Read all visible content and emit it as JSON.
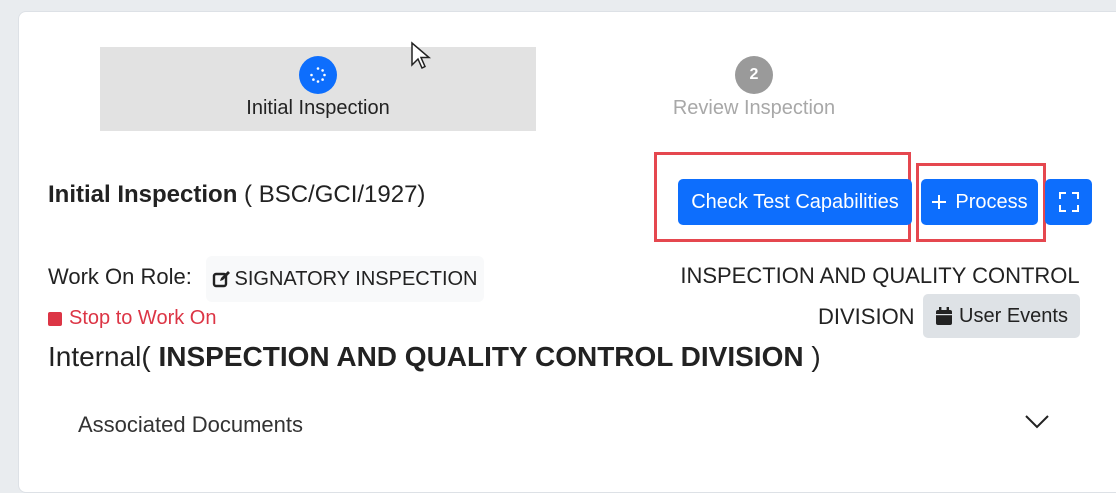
{
  "stepper": {
    "steps": [
      {
        "label": "Initial Inspection",
        "state": "active",
        "number": ""
      },
      {
        "label": "Review Inspection",
        "state": "inactive",
        "number": "2"
      }
    ]
  },
  "header": {
    "title": "Initial Inspection",
    "code": " ( BSC/GCI/1927)"
  },
  "actions": {
    "check_label": "Check Test Capabilities",
    "process_label": "Process",
    "process_icon": "plus-icon",
    "expand_icon": "fullscreen-icon"
  },
  "role": {
    "label": "Work On Role:",
    "value": "SIGNATORY INSPECTION",
    "icon": "edit-icon"
  },
  "stop": {
    "label": "Stop to Work On",
    "icon": "stop-icon"
  },
  "division": {
    "line1": "INSPECTION AND QUALITY CONTROL",
    "line2": "DIVISION",
    "events_label": "User Events",
    "events_icon": "calendar-icon"
  },
  "internal": {
    "prefix": "Internal(",
    "name": " INSPECTION AND QUALITY CONTROL DIVISION ",
    "suffix": ")"
  },
  "accordion": {
    "title": "Associated Documents"
  },
  "colors": {
    "primary": "#0d6efd",
    "danger": "#dc3545",
    "highlight": "#e5474f"
  }
}
